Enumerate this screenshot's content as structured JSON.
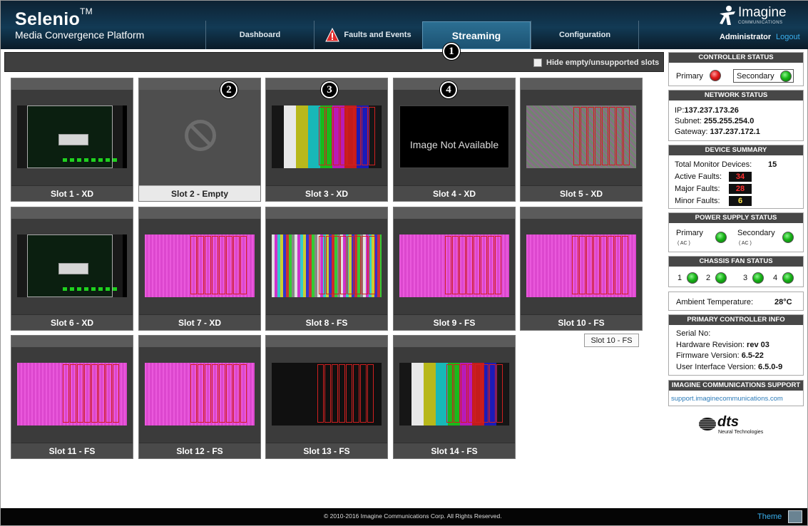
{
  "brand": {
    "title": "Selenio",
    "tm": "TM",
    "subtitle": "Media Convergence Platform"
  },
  "logo": {
    "name": "Imagine",
    "sub": "COMMUNICATIONS"
  },
  "nav": {
    "dashboard": "Dashboard",
    "faults": "Faults and Events",
    "streaming": "Streaming",
    "configuration": "Configuration"
  },
  "user": {
    "name": "Administrator",
    "logout": "Logout"
  },
  "toolbar": {
    "hide_label": "Hide empty/unsupported slots"
  },
  "callouts": [
    "1",
    "2",
    "3",
    "4"
  ],
  "slots": [
    {
      "label": "Slot 1 - XD",
      "thumb": "xd"
    },
    {
      "label": "Slot 2 - Empty",
      "thumb": "empty"
    },
    {
      "label": "Slot 3 - XD",
      "thumb": "colorbars"
    },
    {
      "label": "Slot 4 - XD",
      "thumb": "not-available",
      "na_text": "Image Not Available"
    },
    {
      "label": "Slot 5 - XD",
      "thumb": "noise"
    },
    {
      "label": "Slot 6 - XD",
      "thumb": "xd"
    },
    {
      "label": "Slot 7 - XD",
      "thumb": "pink"
    },
    {
      "label": "Slot 8 - FS",
      "thumb": "multibars"
    },
    {
      "label": "Slot 9 - FS",
      "thumb": "pink"
    },
    {
      "label": "Slot 10 - FS",
      "thumb": "pink"
    },
    {
      "label": "Slot 11 - FS",
      "thumb": "pink"
    },
    {
      "label": "Slot 12 - FS",
      "thumb": "pink"
    },
    {
      "label": "Slot 13 - FS",
      "thumb": "dark"
    },
    {
      "label": "Slot 14 - FS",
      "thumb": "colorbars"
    }
  ],
  "tooltip": "Slot 10 - FS",
  "controller_status": {
    "title": "CONTROLLER STATUS",
    "primary": "Primary",
    "secondary": "Secondary",
    "primary_color": "#e01b1b",
    "secondary_color": "#18b418"
  },
  "network_status": {
    "title": "NETWORK STATUS",
    "ip_label": "IP:",
    "ip": "137.237.173.26",
    "subnet_label": "Subnet:",
    "subnet": "255.255.254.0",
    "gateway_label": "Gateway:",
    "gateway": "137.237.172.1"
  },
  "device_summary": {
    "title": "DEVICE SUMMARY",
    "total_label": "Total Monitor Devices:",
    "total": "15",
    "active_label": "Active Faults:",
    "active": "34",
    "major_label": "Major Faults:",
    "major": "28",
    "minor_label": "Minor Faults:",
    "minor": "6"
  },
  "power_supply": {
    "title": "POWER SUPPLY STATUS",
    "primary": "Primary",
    "secondary": "Secondary",
    "ac": "( AC )"
  },
  "fan_status": {
    "title": "CHASSIS FAN STATUS",
    "fans": [
      "1",
      "2",
      "3",
      "4"
    ]
  },
  "ambient": {
    "label": "Ambient Temperature:",
    "value": "28°C"
  },
  "controller_info": {
    "title": "PRIMARY CONTROLLER INFO",
    "serial_label": "Serial No:",
    "hw_label": "Hardware Revision:",
    "hw": "rev 03",
    "fw_label": "Firmware Version:",
    "fw": "6.5-22",
    "ui_label": "User Interface Version:",
    "ui": "6.5.0-9"
  },
  "support": {
    "title": "IMAGINE COMMUNICATIONS SUPPORT",
    "link": "support.imaginecommunications.com"
  },
  "dts": {
    "name": "dts",
    "sub": "Neural Technologies"
  },
  "footer": {
    "copyright": "© 2010-2016 Imagine Communications Corp. All Rights Reserved.",
    "theme": "Theme"
  }
}
